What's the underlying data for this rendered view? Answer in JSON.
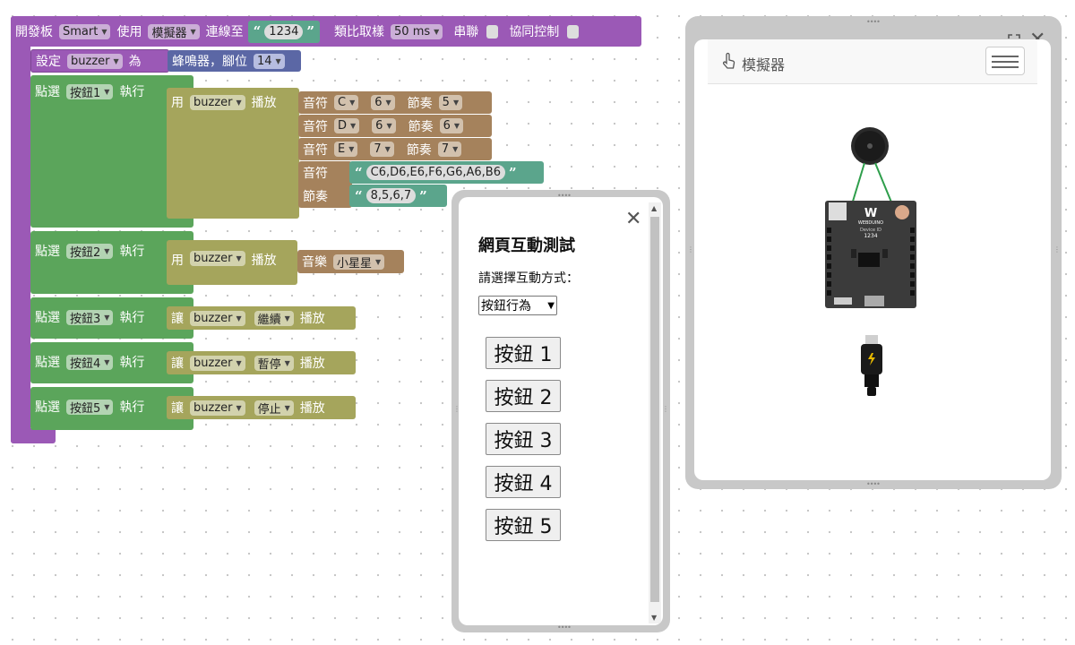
{
  "blocks": {
    "board": {
      "label_board": "開發板",
      "board_value": "Smart",
      "label_use": "使用",
      "mode_value": "模擬器",
      "label_connect": "連線至",
      "device_id": "1234",
      "label_sampling": "類比取樣",
      "sampling_value": "50 ms",
      "label_serial": "串聯",
      "label_coop": "協同控制"
    },
    "set_buzzer": {
      "label_set": "設定",
      "var_name": "buzzer",
      "label_as": "為",
      "device_label": "蜂鳴器，腳位",
      "pin_value": "14"
    },
    "handlers": [
      {
        "label_click": "點選",
        "button": "按鈕1",
        "label_do": "執行"
      },
      {
        "label_click": "點選",
        "button": "按鈕2",
        "label_do": "執行"
      },
      {
        "label_click": "點選",
        "button": "按鈕3",
        "label_do": "執行"
      },
      {
        "label_click": "點選",
        "button": "按鈕4",
        "label_do": "執行"
      },
      {
        "label_click": "點選",
        "button": "按鈕5",
        "label_do": "執行"
      }
    ],
    "play1": {
      "label_use": "用",
      "var": "buzzer",
      "label_play": "播放",
      "notes": [
        {
          "label_note": "音符",
          "note": "C",
          "octave": "6",
          "label_beat": "節奏",
          "beat": "5"
        },
        {
          "label_note": "音符",
          "note": "D",
          "octave": "6",
          "label_beat": "節奏",
          "beat": "6"
        },
        {
          "label_note": "音符",
          "note": "E",
          "octave": "7",
          "label_beat": "節奏",
          "beat": "7"
        }
      ],
      "label_notes": "音符",
      "notes_string": "C6,D6,E6,F6,G6,A6,B6",
      "label_beats": "節奏",
      "beats_string": "8,5,6,7"
    },
    "play2": {
      "label_use": "用",
      "var": "buzzer",
      "label_play": "播放",
      "label_music": "音樂",
      "music": "小星星"
    },
    "actions": [
      {
        "label_let": "讓",
        "var": "buzzer",
        "action": "繼續",
        "label_play": "播放"
      },
      {
        "label_let": "讓",
        "var": "buzzer",
        "action": "暫停",
        "label_play": "播放"
      },
      {
        "label_let": "讓",
        "var": "buzzer",
        "action": "停止",
        "label_play": "播放"
      }
    ]
  },
  "test_panel": {
    "title": "網頁互動測試",
    "prompt": "請選擇互動方式：",
    "select_value": "按鈕行為",
    "buttons": [
      "按鈕 1",
      "按鈕 2",
      "按鈕 3",
      "按鈕 4",
      "按鈕 5"
    ]
  },
  "simulator": {
    "title": "模擬器",
    "board_brand": "WEBDUINO",
    "device_id_label": "Device ID",
    "device_id": "1234"
  },
  "colors": {
    "purple": "#9b59b6",
    "green": "#5ba55b",
    "olive": "#a5a55c",
    "brown": "#a5825c",
    "teal": "#5ba58c",
    "blue": "#5b67a5"
  },
  "icons": [
    "dropdown-arrow-icon",
    "close-icon",
    "fullscreen-icon",
    "hand-pointer-icon",
    "hamburger-menu-icon",
    "usb-cable-icon"
  ]
}
